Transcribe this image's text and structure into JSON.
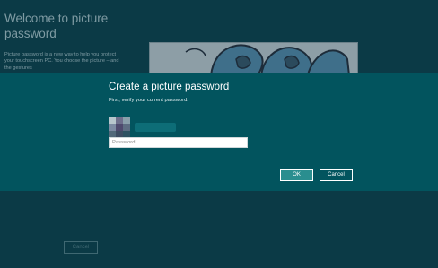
{
  "background": {
    "title": "Welcome to picture password",
    "description": "Picture password is a new way to help you protect your touchscreen PC. You choose the picture – and the gestures",
    "cancel_label": "Cancel"
  },
  "dialog": {
    "title": "Create a picture password",
    "subtitle": "First, verify your current password.",
    "password_placeholder": "Password",
    "ok_label": "OK",
    "cancel_label": "Cancel"
  },
  "colors": {
    "page_background": "#0b3a46",
    "dialog_background": "#02545e",
    "accent_button": "#2a8e8f"
  }
}
